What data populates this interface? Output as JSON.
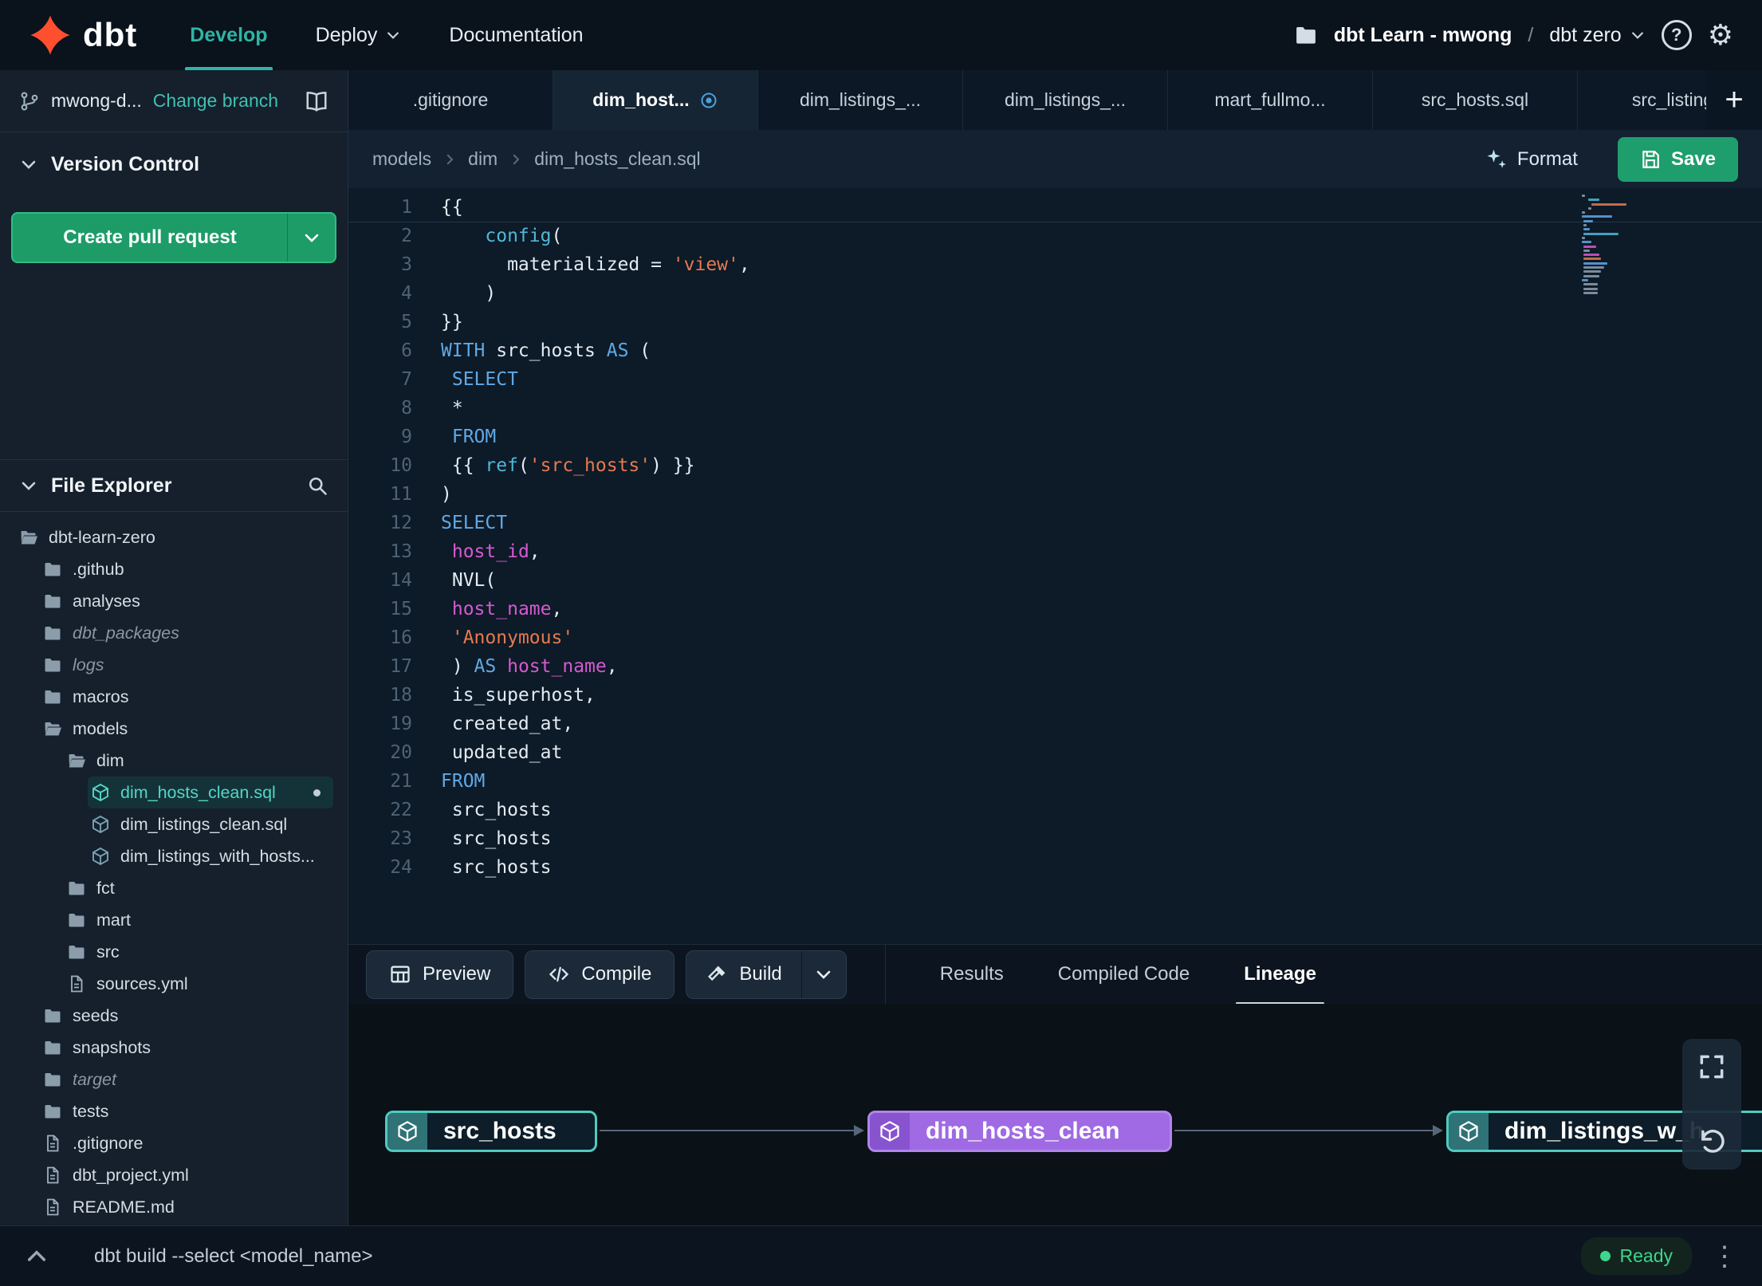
{
  "colors": {
    "accent_teal": "#2eb5a5",
    "brand_orange": "#ff4f2e",
    "button_green": "#1e9e6c",
    "node_purple": "#9f6ae3",
    "node_teal_border": "#4ecbc0",
    "ready_green": "#3dd68c"
  },
  "navbar": {
    "logo_text": "dbt",
    "menu": [
      {
        "label": "Develop",
        "active": true
      },
      {
        "label": "Deploy",
        "chevron": true
      },
      {
        "label": "Documentation"
      }
    ],
    "project_name": "dbt Learn - mwong",
    "separator": "/",
    "environment": "dbt zero"
  },
  "sidebar": {
    "branch": {
      "name": "mwong-d...",
      "change_label": "Change branch"
    },
    "version_control": {
      "title": "Version Control",
      "create_pr_label": "Create pull request"
    },
    "file_explorer": {
      "title": "File Explorer",
      "tree": [
        {
          "name": "dbt-learn-zero",
          "type": "folder-open",
          "level": 0
        },
        {
          "name": ".github",
          "type": "folder",
          "level": 1
        },
        {
          "name": "analyses",
          "type": "folder",
          "level": 1
        },
        {
          "name": "dbt_packages",
          "type": "folder",
          "level": 1,
          "dim": true
        },
        {
          "name": "logs",
          "type": "folder",
          "level": 1,
          "dim": true
        },
        {
          "name": "macros",
          "type": "folder",
          "level": 1
        },
        {
          "name": "models",
          "type": "folder-open",
          "level": 1
        },
        {
          "name": "dim",
          "type": "folder-open",
          "level": 2
        },
        {
          "name": "dim_hosts_clean.sql",
          "type": "model",
          "level": 3,
          "selected": true,
          "modified": true
        },
        {
          "name": "dim_listings_clean.sql",
          "type": "model",
          "level": 3
        },
        {
          "name": "dim_listings_with_hosts...",
          "type": "model",
          "level": 3
        },
        {
          "name": "fct",
          "type": "folder",
          "level": 2
        },
        {
          "name": "mart",
          "type": "folder",
          "level": 2
        },
        {
          "name": "src",
          "type": "folder",
          "level": 2
        },
        {
          "name": "sources.yml",
          "type": "file",
          "level": 2
        },
        {
          "name": "seeds",
          "type": "folder",
          "level": 1
        },
        {
          "name": "snapshots",
          "type": "folder",
          "level": 1
        },
        {
          "name": "target",
          "type": "folder",
          "level": 1,
          "dim": true
        },
        {
          "name": "tests",
          "type": "folder",
          "level": 1
        },
        {
          "name": ".gitignore",
          "type": "file",
          "level": 1
        },
        {
          "name": "dbt_project.yml",
          "type": "file",
          "level": 1
        },
        {
          "name": "README.md",
          "type": "file",
          "level": 1
        }
      ]
    }
  },
  "tab_bar": {
    "new_tab_label": "+",
    "tabs": [
      {
        "label": ".gitignore"
      },
      {
        "label": "dim_host...",
        "active": true,
        "pinned": true
      },
      {
        "label": "dim_listings_..."
      },
      {
        "label": "dim_listings_..."
      },
      {
        "label": "mart_fullmo..."
      },
      {
        "label": "src_hosts.sql"
      },
      {
        "label": "src_listings."
      }
    ]
  },
  "breadcrumb": [
    "models",
    "dim",
    "dim_hosts_clean.sql"
  ],
  "editor_actions": {
    "format": "Format",
    "save": "Save"
  },
  "editor": {
    "code": [
      {
        "n": 1,
        "t": [
          [
            "{{",
            "p"
          ]
        ]
      },
      {
        "n": 2,
        "t": [
          [
            "    ",
            "p"
          ],
          [
            "config",
            "f"
          ],
          [
            "(",
            "p"
          ]
        ]
      },
      {
        "n": 3,
        "t": [
          [
            "      materialized = ",
            "p"
          ],
          [
            "'view'",
            "s"
          ],
          [
            ",",
            "p"
          ]
        ]
      },
      {
        "n": 4,
        "t": [
          [
            "    )",
            "p"
          ]
        ]
      },
      {
        "n": 5,
        "t": [
          [
            "}}",
            "p"
          ]
        ]
      },
      {
        "n": 6,
        "t": [
          [
            "WITH",
            "k"
          ],
          [
            " src_hosts ",
            "p"
          ],
          [
            "AS",
            "k"
          ],
          [
            " (",
            "p"
          ]
        ]
      },
      {
        "n": 7,
        "t": [
          [
            " ",
            "p"
          ],
          [
            "SELECT",
            "k"
          ]
        ]
      },
      {
        "n": 8,
        "t": [
          [
            " *",
            "p"
          ]
        ]
      },
      {
        "n": 9,
        "t": [
          [
            " ",
            "p"
          ],
          [
            "FROM",
            "k"
          ]
        ]
      },
      {
        "n": 10,
        "t": [
          [
            " {{ ",
            "p"
          ],
          [
            "ref",
            "f"
          ],
          [
            "(",
            "p"
          ],
          [
            "'src_hosts'",
            "s"
          ],
          [
            ") }}",
            "p"
          ]
        ]
      },
      {
        "n": 11,
        "t": [
          [
            ")",
            "p"
          ]
        ]
      },
      {
        "n": 12,
        "t": [
          [
            "SELECT",
            "k"
          ]
        ]
      },
      {
        "n": 13,
        "t": [
          [
            " ",
            "p"
          ],
          [
            "host_id",
            "v"
          ],
          [
            ",",
            "p"
          ]
        ]
      },
      {
        "n": 14,
        "t": [
          [
            " NVL(",
            "p"
          ]
        ]
      },
      {
        "n": 15,
        "t": [
          [
            " ",
            "p"
          ],
          [
            "host_name",
            "v"
          ],
          [
            ",",
            "p"
          ]
        ]
      },
      {
        "n": 16,
        "t": [
          [
            " ",
            "p"
          ],
          [
            "'Anonymous'",
            "s"
          ]
        ]
      },
      {
        "n": 17,
        "t": [
          [
            " ) ",
            "p"
          ],
          [
            "AS",
            "k"
          ],
          [
            " ",
            "p"
          ],
          [
            "host_name",
            "v"
          ],
          [
            ",",
            "p"
          ]
        ]
      },
      {
        "n": 18,
        "t": [
          [
            " is_superhost,",
            "p"
          ]
        ]
      },
      {
        "n": 19,
        "t": [
          [
            " created_at,",
            "p"
          ]
        ]
      },
      {
        "n": 20,
        "t": [
          [
            " updated_at",
            "p"
          ]
        ]
      },
      {
        "n": 21,
        "t": [
          [
            "FROM",
            "k"
          ]
        ]
      },
      {
        "n": 22,
        "t": [
          [
            " src_hosts",
            "p"
          ]
        ]
      },
      {
        "n": 23,
        "t": [
          [
            " src_hosts",
            "p"
          ]
        ]
      },
      {
        "n": 24,
        "t": [
          [
            " src_hosts",
            "p"
          ]
        ]
      }
    ]
  },
  "bottom_panel": {
    "buttons": [
      {
        "label": "Preview",
        "icon": "table"
      },
      {
        "label": "Compile",
        "icon": "code"
      },
      {
        "label": "Build",
        "icon": "hammer",
        "has_dropdown": true
      }
    ],
    "tabs": [
      {
        "label": "Results"
      },
      {
        "label": "Compiled Code"
      },
      {
        "label": "Lineage",
        "active": true
      }
    ]
  },
  "lineage": {
    "nodes": [
      {
        "label": "src_hosts",
        "variant": "teal"
      },
      {
        "label": "dim_hosts_clean",
        "variant": "purple"
      },
      {
        "label": "dim_listings_w_h",
        "variant": "teal"
      }
    ]
  },
  "status_bar": {
    "command": "dbt build --select <model_name>",
    "status": "Ready"
  }
}
